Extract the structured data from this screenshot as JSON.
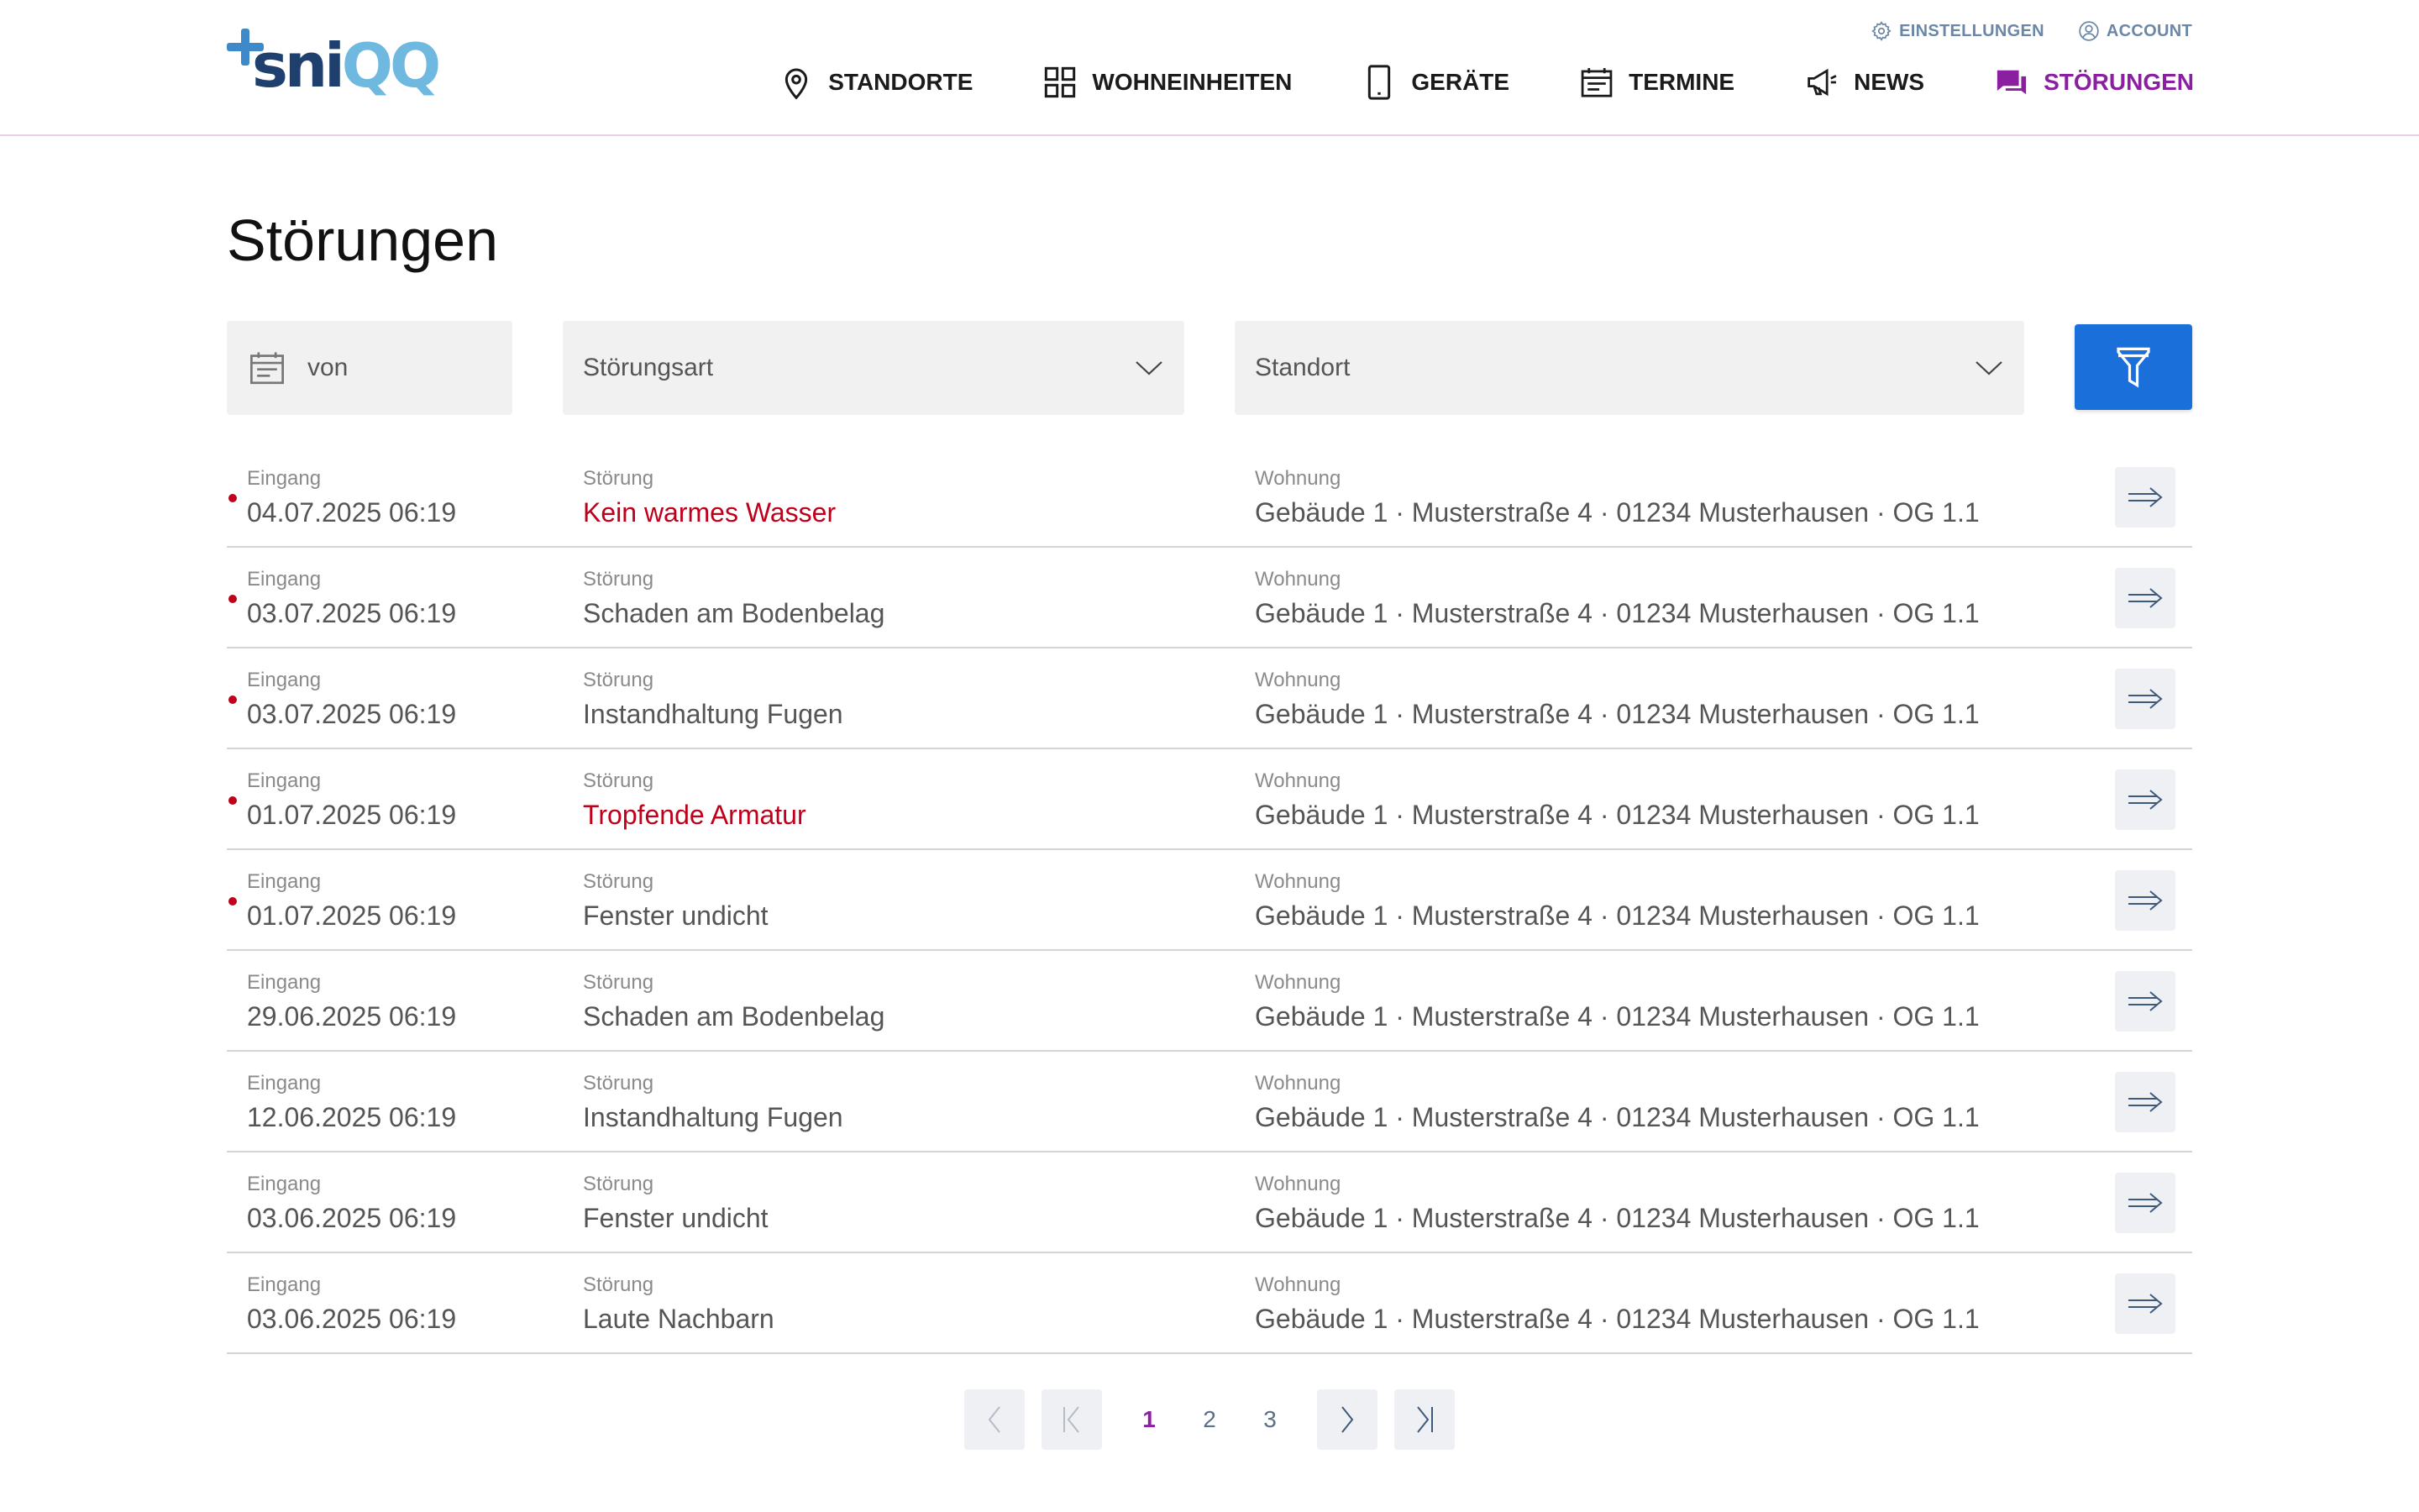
{
  "brand": {
    "prefix": "sni",
    "suffix": "QQ",
    "accent": "#3d89c9",
    "dark": "#1f3f6e",
    "light": "#6fb8e0"
  },
  "top_links": [
    {
      "label": "EINSTELLUNGEN",
      "icon": "gear-icon"
    },
    {
      "label": "ACCOUNT",
      "icon": "user-icon"
    }
  ],
  "nav": [
    {
      "label": "STANDORTE",
      "icon": "location-pin-icon",
      "active": false
    },
    {
      "label": "WOHNEINHEITEN",
      "icon": "grid-icon",
      "active": false
    },
    {
      "label": "GERÄTE",
      "icon": "tablet-icon",
      "active": false
    },
    {
      "label": "TERMINE",
      "icon": "calendar-icon",
      "active": false
    },
    {
      "label": "NEWS",
      "icon": "megaphone-icon",
      "active": false
    },
    {
      "label": "STÖRUNGEN",
      "icon": "chat-icon",
      "active": true
    }
  ],
  "page": {
    "title": "Störungen"
  },
  "filters": {
    "date_placeholder": "von",
    "type_placeholder": "Störungsart",
    "location_placeholder": "Standort",
    "filter_button_icon": "funnel-icon"
  },
  "columns": {
    "entry": "Eingang",
    "issue": "Störung",
    "apartment": "Wohnung"
  },
  "rows": [
    {
      "unread": true,
      "date": "04.07.2025 06:19",
      "issue": "Kein warmes Wasser",
      "urgent": true,
      "apartment": "Gebäude 1 · Musterstraße 4 · 01234 Musterhausen · OG 1.1"
    },
    {
      "unread": true,
      "date": "03.07.2025 06:19",
      "issue": "Schaden am Bodenbelag",
      "urgent": false,
      "apartment": "Gebäude 1 · Musterstraße 4 · 01234 Musterhausen · OG 1.1"
    },
    {
      "unread": true,
      "date": "03.07.2025 06:19",
      "issue": "Instandhaltung Fugen",
      "urgent": false,
      "apartment": "Gebäude 1 · Musterstraße 4 · 01234 Musterhausen · OG 1.1"
    },
    {
      "unread": true,
      "date": "01.07.2025 06:19",
      "issue": "Tropfende Armatur",
      "urgent": true,
      "apartment": "Gebäude 1 · Musterstraße 4 · 01234 Musterhausen · OG 1.1"
    },
    {
      "unread": true,
      "date": "01.07.2025 06:19",
      "issue": "Fenster undicht",
      "urgent": false,
      "apartment": "Gebäude 1 · Musterstraße 4 · 01234 Musterhausen · OG 1.1"
    },
    {
      "unread": false,
      "date": "29.06.2025 06:19",
      "issue": "Schaden am Bodenbelag",
      "urgent": false,
      "apartment": "Gebäude 1 · Musterstraße 4 · 01234 Musterhausen · OG 1.1"
    },
    {
      "unread": false,
      "date": "12.06.2025 06:19",
      "issue": "Instandhaltung Fugen",
      "urgent": false,
      "apartment": "Gebäude 1 · Musterstraße 4 · 01234 Musterhausen · OG 1.1"
    },
    {
      "unread": false,
      "date": "03.06.2025 06:19",
      "issue": "Fenster undicht",
      "urgent": false,
      "apartment": "Gebäude 1 · Musterstraße 4 · 01234 Musterhausen · OG 1.1"
    },
    {
      "unread": false,
      "date": "03.06.2025 06:19",
      "issue": "Laute Nachbarn",
      "urgent": false,
      "apartment": "Gebäude 1 · Musterstraße 4 · 01234 Musterhausen · OG 1.1"
    }
  ],
  "pagination": {
    "pages": [
      "1",
      "2",
      "3"
    ],
    "current": "1"
  },
  "colors": {
    "active": "#8a1fa0",
    "urgent": "#c0001a",
    "primary_button": "#1b6fdb"
  }
}
